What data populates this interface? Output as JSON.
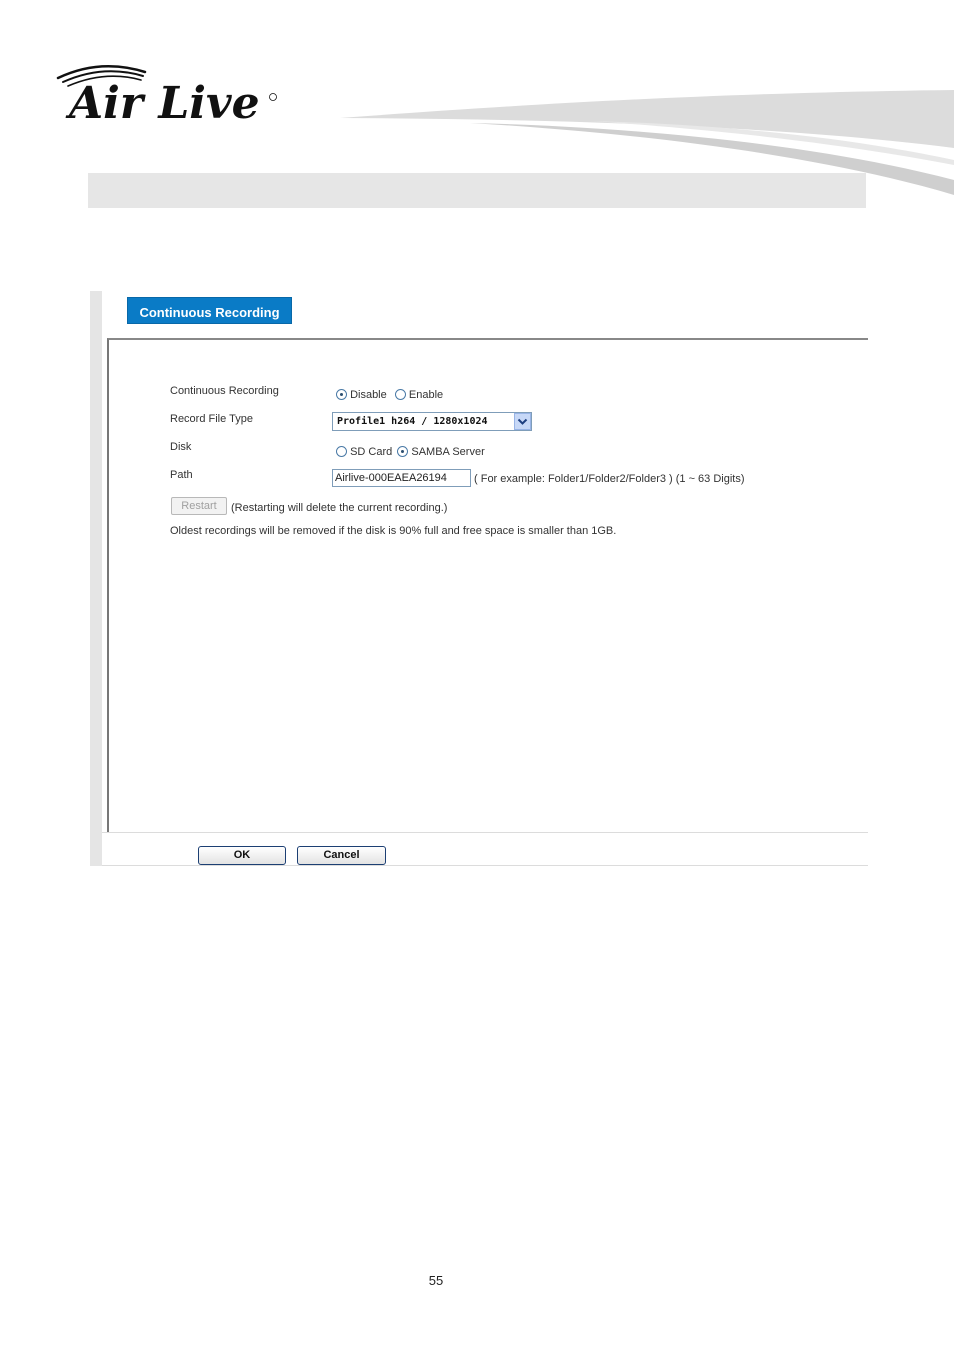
{
  "brand": {
    "logo_text": "Air Live"
  },
  "tab": {
    "label": "Continuous Recording"
  },
  "form": {
    "continuous_recording": {
      "label": "Continuous Recording",
      "options": [
        {
          "label": "Disable",
          "selected": true
        },
        {
          "label": "Enable",
          "selected": false
        }
      ]
    },
    "record_file_type": {
      "label": "Record File Type",
      "selected_value": "Profile1 h264 / 1280x1024"
    },
    "disk": {
      "label": "Disk",
      "options": [
        {
          "label": "SD Card",
          "selected": false
        },
        {
          "label": "SAMBA Server",
          "selected": true
        }
      ]
    },
    "path": {
      "label": "Path",
      "value": "Airlive-000EAEA26194",
      "hint": "( For example: Folder1/Folder2/Folder3 ) (1 ~ 63 Digits)"
    },
    "restart": {
      "label": "Restart",
      "note": "(Restarting will delete the current recording.)"
    },
    "notice": "Oldest recordings will be removed if the disk is 90% full and free space is smaller than 1GB."
  },
  "footer": {
    "ok_label": "OK",
    "cancel_label": "Cancel"
  },
  "page": {
    "number": "55"
  },
  "colors": {
    "tab_blue": "#0a7bc6",
    "header_gray": "#e6e6e6"
  }
}
